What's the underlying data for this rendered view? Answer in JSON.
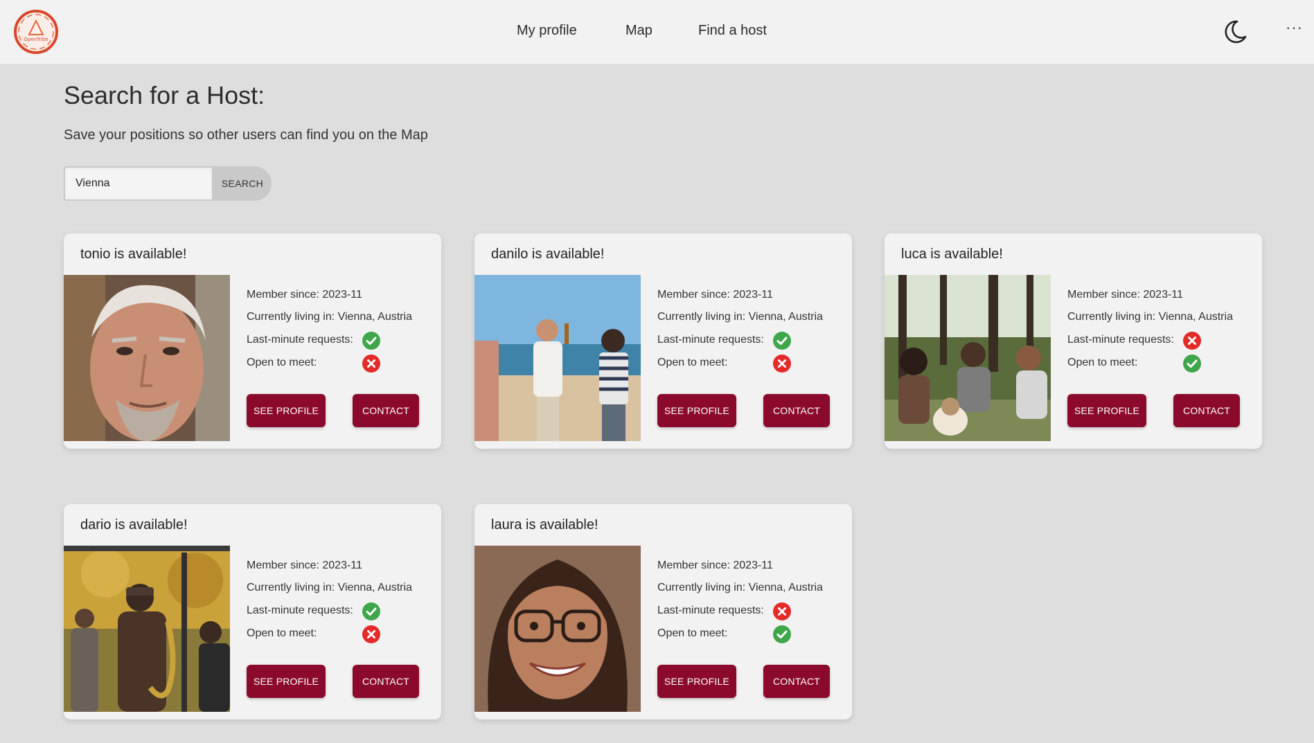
{
  "header": {
    "logo_text": "OpenTribe",
    "nav": [
      {
        "label": "My profile"
      },
      {
        "label": "Map"
      },
      {
        "label": "Find a host"
      }
    ],
    "theme_icon": "moon-icon",
    "more_label": "···"
  },
  "main": {
    "title": "Search for a Host:",
    "subtitle": "Save your positions so other users can find you on the Map",
    "search": {
      "value": "Vienna",
      "button_label": "SEARCH"
    }
  },
  "labels": {
    "member_since": "Member since: 2023-11",
    "living": "Currently living in: Vienna, Austria",
    "last_minute": "Last-minute requests:",
    "open_to_meet": "Open to meet:",
    "see_profile": "SEE PROFILE",
    "contact": "CONTACT"
  },
  "colors": {
    "accent": "#8b0a2b",
    "check": "#3fa64a",
    "cross": "#e52a2a"
  },
  "cards": [
    {
      "title": "tonio is available!",
      "member_since": "Member since: 2023-11",
      "living": "Currently living in: Vienna, Austria",
      "last_minute": "yes",
      "open_to_meet": "no"
    },
    {
      "title": "danilo is available!",
      "member_since": "Member since: 2023-11",
      "living": "Currently living in: Vienna, Austria",
      "last_minute": "yes",
      "open_to_meet": "no"
    },
    {
      "title": "luca is available!",
      "member_since": "Member since: 2023-11",
      "living": "Currently living in: Vienna, Austria",
      "last_minute": "no",
      "open_to_meet": "yes"
    },
    {
      "title": "dario is available!",
      "member_since": "Member since: 2023-11",
      "living": "Currently living in: Vienna, Austria",
      "last_minute": "yes",
      "open_to_meet": "no"
    },
    {
      "title": "laura is available!",
      "member_since": "Member since: 2023-11",
      "living": "Currently living in: Vienna, Austria",
      "last_minute": "no",
      "open_to_meet": "yes"
    }
  ]
}
